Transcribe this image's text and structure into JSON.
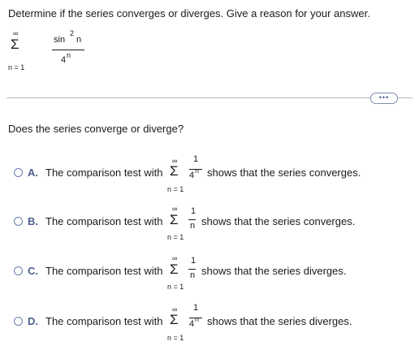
{
  "question": {
    "prompt": "Determine if the series converges or diverges. Give a reason for your answer.",
    "series": {
      "upper_limit": "∞",
      "sigma": "Σ",
      "lower_limit": "n = 1",
      "numerator_func": "sin",
      "numerator_exp": "2",
      "numerator_var": "n",
      "denominator_base": "4",
      "denominator_exp": "n"
    }
  },
  "more_button_label": "•••",
  "sub_question": "Does the series converge or diverge?",
  "options": [
    {
      "letter": "A.",
      "prefix": "The comparison test with",
      "upper": "∞",
      "sigma": "Σ",
      "lower": "n = 1",
      "frac_num": "1",
      "frac_den": "4",
      "frac_den_exp": "n",
      "suffix": "shows that the series converges."
    },
    {
      "letter": "B.",
      "prefix": "The comparison test with",
      "upper": "∞",
      "sigma": "Σ",
      "lower": "n = 1",
      "frac_num": "1",
      "frac_den": "n",
      "frac_den_exp": "",
      "suffix": "shows that the series converges."
    },
    {
      "letter": "C.",
      "prefix": "The comparison test with",
      "upper": "∞",
      "sigma": "Σ",
      "lower": "n = 1",
      "frac_num": "1",
      "frac_den": "n",
      "frac_den_exp": "",
      "suffix": "shows that the series diverges."
    },
    {
      "letter": "D.",
      "prefix": "The comparison test with",
      "upper": "∞",
      "sigma": "Σ",
      "lower": "n = 1",
      "frac_num": "1",
      "frac_den": "4",
      "frac_den_exp": "n",
      "suffix": "shows that the series diverges."
    }
  ]
}
